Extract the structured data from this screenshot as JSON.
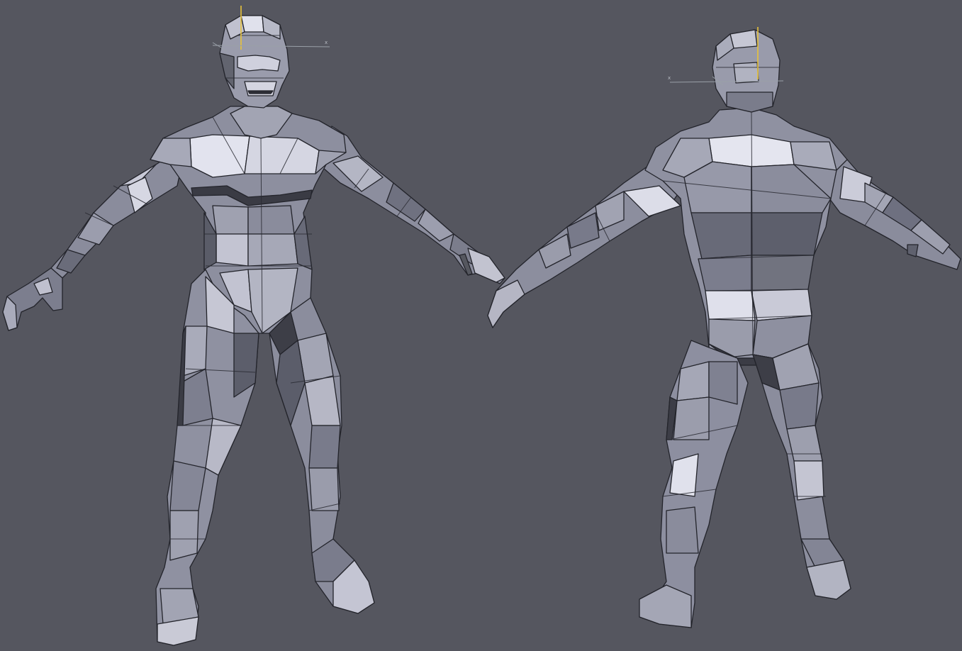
{
  "viewport": {
    "background": "#55565f",
    "mesh_colors": {
      "highlight": "#d9dae6",
      "light": "#a4a6b6",
      "mid": "#7b7d8d",
      "dark": "#51525e",
      "shadow": "#2f3038",
      "edge": "#23242b"
    },
    "gizmo_colors": {
      "y_axis": "#e8c23a",
      "x_axis": "#9aa0a8"
    },
    "gizmo_axis_label": "x",
    "figures": [
      {
        "name": "front-view",
        "label": ""
      },
      {
        "name": "back-view",
        "label": ""
      }
    ]
  }
}
